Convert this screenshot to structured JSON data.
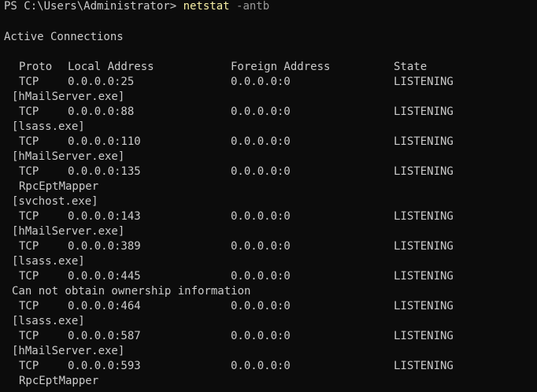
{
  "prompt": {
    "ps": "PS C:\\Users\\Administrator> ",
    "command": "netstat",
    "args": " -antb"
  },
  "section_title": "Active Connections",
  "headers": {
    "proto": "Proto",
    "local": "Local Address",
    "foreign": "Foreign Address",
    "state": "State"
  },
  "rows": [
    {
      "proto": "TCP",
      "local": "0.0.0.0:25",
      "foreign": "0.0.0.0:0",
      "state": "LISTENING"
    },
    {
      "proto": "TCP",
      "local": "0.0.0.0:88",
      "foreign": "0.0.0.0:0",
      "state": "LISTENING"
    },
    {
      "proto": "TCP",
      "local": "0.0.0.0:110",
      "foreign": "0.0.0.0:0",
      "state": "LISTENING"
    },
    {
      "proto": "TCP",
      "local": "0.0.0.0:135",
      "foreign": "0.0.0.0:0",
      "state": "LISTENING"
    },
    {
      "proto": "TCP",
      "local": "0.0.0.0:143",
      "foreign": "0.0.0.0:0",
      "state": "LISTENING"
    },
    {
      "proto": "TCP",
      "local": "0.0.0.0:389",
      "foreign": "0.0.0.0:0",
      "state": "LISTENING"
    },
    {
      "proto": "TCP",
      "local": "0.0.0.0:445",
      "foreign": "0.0.0.0:0",
      "state": "LISTENING"
    },
    {
      "proto": "TCP",
      "local": "0.0.0.0:464",
      "foreign": "0.0.0.0:0",
      "state": "LISTENING"
    },
    {
      "proto": "TCP",
      "local": "0.0.0.0:587",
      "foreign": "0.0.0.0:0",
      "state": "LISTENING"
    },
    {
      "proto": "TCP",
      "local": "0.0.0.0:593",
      "foreign": "0.0.0.0:0",
      "state": "LISTENING"
    }
  ],
  "owners": {
    "hmail": "[hMailServer.exe]",
    "lsass": "[lsass.exe]",
    "rpc": "RpcEptMapper",
    "svchost": "[svchost.exe]",
    "no_owner": "Can not obtain ownership information"
  },
  "colors": {
    "background": "#0c0c0c",
    "text": "#cccccc",
    "command": "#f9f1a5",
    "argument": "#9a9a9a"
  }
}
